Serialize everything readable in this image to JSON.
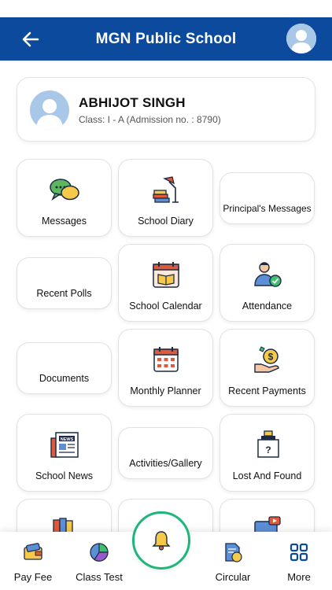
{
  "header": {
    "title": "MGN Public School"
  },
  "profile": {
    "name": "ABHIJOT SINGH",
    "class_info": "Class: I - A (Admission no. : 8790)"
  },
  "tiles": {
    "messages": "Messages",
    "school_diary": "School Diary",
    "principals_messages": "Principal's Messages",
    "recent_polls": "Recent Polls",
    "school_calendar": "School Calendar",
    "attendance": "Attendance",
    "documents": "Documents",
    "monthly_planner": "Monthly Planner",
    "recent_payments": "Recent Payments",
    "school_news": "School News",
    "activities_gallery": "Activities/Gallery",
    "lost_and_found": "Lost And Found"
  },
  "bottom_nav": {
    "pay_fee": "Pay Fee",
    "class_test": "Class Test",
    "circular": "Circular",
    "more": "More"
  },
  "colors": {
    "header_bg": "#0b4a9c",
    "bell_ring": "#1fb67a"
  }
}
